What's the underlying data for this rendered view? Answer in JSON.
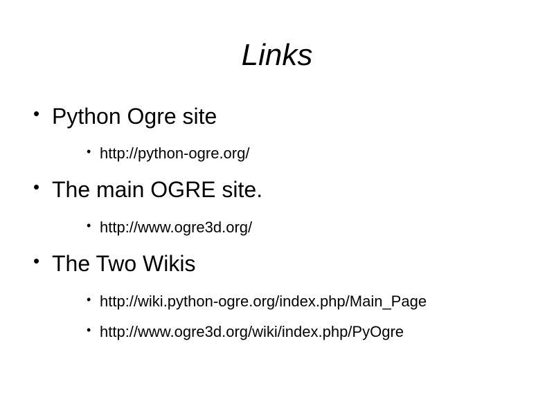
{
  "slide": {
    "title": "Links",
    "bullets": [
      {
        "text": "Python Ogre site",
        "subitems": [
          "http://python-ogre.org/"
        ]
      },
      {
        "text": "The main OGRE site.",
        "subitems": [
          "http://www.ogre3d.org/"
        ]
      },
      {
        "text": "The Two Wikis",
        "subitems": [
          "http://wiki.python-ogre.org/index.php/Main_Page",
          "http://www.ogre3d.org/wiki/index.php/PyOgre"
        ]
      }
    ],
    "bullet_glyph": "•"
  }
}
